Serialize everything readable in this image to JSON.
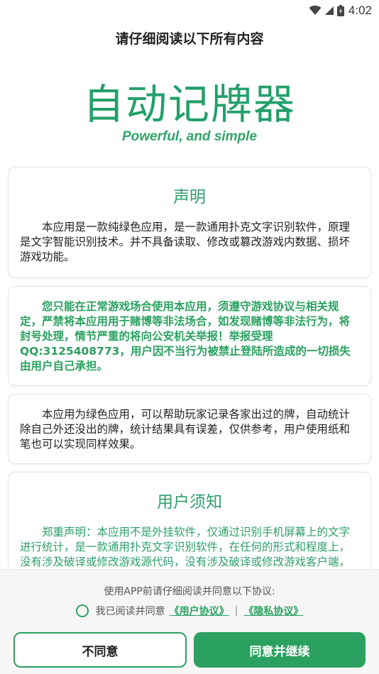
{
  "status_bar": {
    "time": "4:02"
  },
  "header": {
    "title": "请仔细阅读以下所有内容"
  },
  "hero": {
    "app_name": "自动记牌器",
    "tagline": "Powerful, and simple"
  },
  "cards": [
    {
      "title": "声明",
      "text": "本应用是一款纯绿色应用，是一款通用扑克文字识别软件，原理是文字智能识别技术。并不具备读取、修改或篡改游戏内数据、损坏游戏功能。"
    },
    {
      "text": "您只能在正常游戏场合使用本应用，须遵守游戏协议与相关规定，严禁将本应用用于赌博等非法场合，如发现赌博等非法行为，将封号处理，情节严重的将向公安机关举报！举报受理QQ:3125408773，用户因不当行为被禁止登陆所造成的一切损失由用户自己承担。"
    },
    {
      "text": "本应用为绿色应用，可以帮助玩家记录各家出过的牌，自动统计除自己外还没出的牌，统计结果具有误差，仅供参考，用户使用纸和笔也可以实现同样效果。"
    },
    {
      "title": "用户须知",
      "text": "郑重声明：本应用不是外挂软件，仅通过识别手机屏幕上的文字进行统计，是一款通用扑克文字识别软件，在任何的形式和程度上，没有涉及破译或修改游戏源代码，没有涉及破译或修改游戏客户端，没有涉及破译或修改游戏数据封包。"
    }
  ],
  "footer": {
    "prompt": "使用APP前请仔细阅读并同意以下协议:",
    "agree_text": "我已阅读并同意",
    "user_agreement": "《用户协议》",
    "separator": "|",
    "privacy_policy": "《隐私协议》",
    "disagree_label": "不同意",
    "agree_label": "同意并继续"
  },
  "colors": {
    "accent": "#2aa160"
  }
}
